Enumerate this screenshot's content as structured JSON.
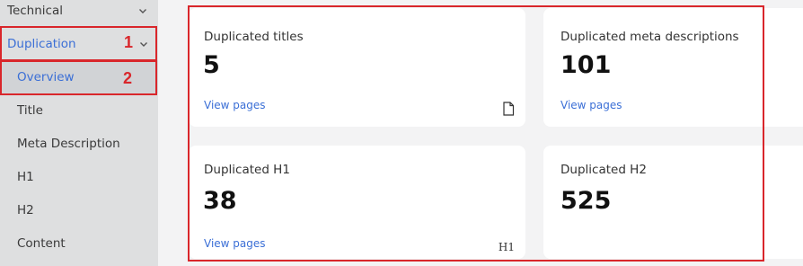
{
  "sidebar": {
    "technical": "Technical",
    "duplication": "Duplication",
    "items": [
      "Overview",
      "Title",
      "Meta Description",
      "H1",
      "H2",
      "Content"
    ]
  },
  "annotations": {
    "one": "1",
    "two": "2"
  },
  "cards": [
    {
      "title": "Duplicated titles",
      "value": "5",
      "link": "View pages",
      "icon": "document-icon"
    },
    {
      "title": "Duplicated meta descriptions",
      "value": "101",
      "link": "View pages",
      "icon": ""
    },
    {
      "title": "Duplicated H1",
      "value": "38",
      "link": "View pages",
      "icon": "h1-icon",
      "icon_text": "H1"
    },
    {
      "title": "Duplicated H2",
      "value": "525",
      "link": "",
      "icon": ""
    }
  ],
  "colors": {
    "accent": "#3b6fd6",
    "annotation": "#d9262b",
    "sidebar_bg": "#dedfe0",
    "page_bg": "#f3f3f4"
  }
}
